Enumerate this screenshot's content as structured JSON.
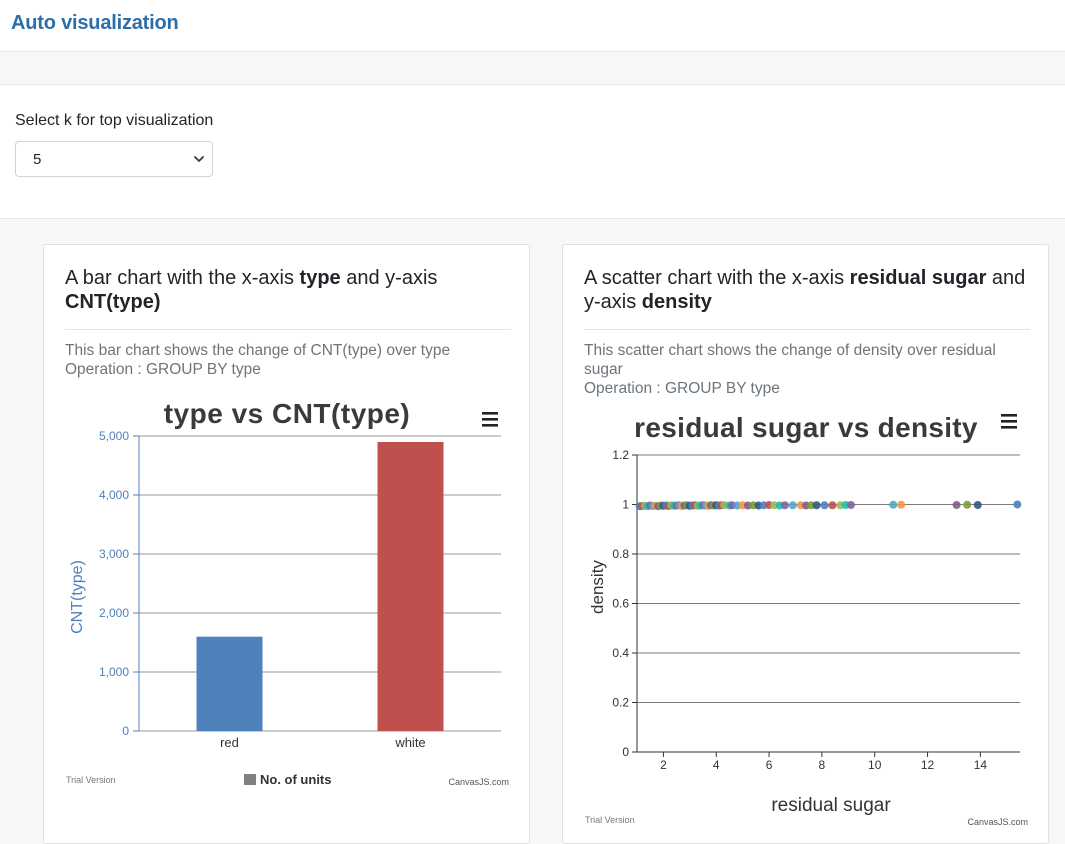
{
  "app": {
    "title": "Auto visualization"
  },
  "controls": {
    "k_label": "Select k for top visualization",
    "k_value": "5"
  },
  "cards": [
    {
      "title_parts": [
        "A bar chart with the x-axis ",
        "type",
        " and y-axis ",
        "CNT(type)"
      ],
      "description": "This bar chart shows the change of CNT(type) over type",
      "operation": "Operation : GROUP BY type",
      "footer_left": "Trial Version",
      "footer_right": "CanvasJS.com",
      "legend": "No. of units",
      "chart_data": {
        "type": "bar",
        "title": "type vs CNT(type)",
        "xlabel": "",
        "ylabel": "CNT(type)",
        "categories": [
          "red",
          "white"
        ],
        "values": [
          1599,
          4898
        ],
        "colors": [
          "#4f81bc",
          "#c0504e"
        ],
        "ylim": [
          0,
          5000
        ],
        "yticks": [
          "0",
          "1,000",
          "2,000",
          "3,000",
          "4,000",
          "5,000"
        ],
        "grid": true,
        "legend_position": "bottom"
      }
    },
    {
      "title_parts": [
        "A scatter chart with the x-axis ",
        "residual sugar",
        " and y-axis ",
        "density"
      ],
      "description": "This scatter chart shows the change of density over residual sugar",
      "operation": "Operation : GROUP BY type",
      "footer_left": "Trial Version",
      "footer_right": "CanvasJS.com",
      "chart_data": {
        "type": "scatter",
        "title": "residual sugar vs density",
        "xlabel": "residual sugar",
        "ylabel": "density",
        "xlim": [
          1,
          15.5
        ],
        "ylim": [
          0,
          1.2
        ],
        "xticks": [
          2,
          4,
          6,
          8,
          10,
          12,
          14
        ],
        "yticks": [
          "0",
          "0.2",
          "0.4",
          "0.6",
          "0.8",
          "1",
          "1.2"
        ],
        "grid": true,
        "point_colors": [
          "#4f81bc",
          "#c0504e",
          "#9bbb58",
          "#23bfaa",
          "#8064a1",
          "#4aacc5",
          "#f79647",
          "#7f6084",
          "#77a033",
          "#33558b"
        ],
        "points": [
          {
            "x": 1.1,
            "y": 0.993
          },
          {
            "x": 1.2,
            "y": 0.994
          },
          {
            "x": 1.3,
            "y": 0.995
          },
          {
            "x": 1.4,
            "y": 0.993
          },
          {
            "x": 1.5,
            "y": 0.996
          },
          {
            "x": 1.6,
            "y": 0.994
          },
          {
            "x": 1.7,
            "y": 0.995
          },
          {
            "x": 1.8,
            "y": 0.993
          },
          {
            "x": 1.9,
            "y": 0.996
          },
          {
            "x": 2.0,
            "y": 0.995
          },
          {
            "x": 2.1,
            "y": 0.996
          },
          {
            "x": 2.2,
            "y": 0.994
          },
          {
            "x": 2.3,
            "y": 0.997
          },
          {
            "x": 2.4,
            "y": 0.995
          },
          {
            "x": 2.5,
            "y": 0.996
          },
          {
            "x": 2.6,
            "y": 0.997
          },
          {
            "x": 2.7,
            "y": 0.994
          },
          {
            "x": 2.8,
            "y": 0.996
          },
          {
            "x": 2.9,
            "y": 0.997
          },
          {
            "x": 3.0,
            "y": 0.995
          },
          {
            "x": 3.1,
            "y": 0.996
          },
          {
            "x": 3.2,
            "y": 0.997
          },
          {
            "x": 3.3,
            "y": 0.995
          },
          {
            "x": 3.4,
            "y": 0.996
          },
          {
            "x": 3.5,
            "y": 0.997
          },
          {
            "x": 3.6,
            "y": 0.996
          },
          {
            "x": 3.7,
            "y": 0.995
          },
          {
            "x": 3.8,
            "y": 0.997
          },
          {
            "x": 3.9,
            "y": 0.996
          },
          {
            "x": 4.0,
            "y": 0.997
          },
          {
            "x": 4.1,
            "y": 0.996
          },
          {
            "x": 4.2,
            "y": 0.997
          },
          {
            "x": 4.3,
            "y": 0.998
          },
          {
            "x": 4.5,
            "y": 0.996
          },
          {
            "x": 4.6,
            "y": 0.997
          },
          {
            "x": 4.8,
            "y": 0.996
          },
          {
            "x": 5.0,
            "y": 0.997
          },
          {
            "x": 5.2,
            "y": 0.996
          },
          {
            "x": 5.4,
            "y": 0.997
          },
          {
            "x": 5.6,
            "y": 0.996
          },
          {
            "x": 5.8,
            "y": 0.997
          },
          {
            "x": 6.0,
            "y": 0.998
          },
          {
            "x": 6.2,
            "y": 0.997
          },
          {
            "x": 6.4,
            "y": 0.996
          },
          {
            "x": 6.6,
            "y": 0.997
          },
          {
            "x": 6.9,
            "y": 0.997
          },
          {
            "x": 7.2,
            "y": 0.997
          },
          {
            "x": 7.4,
            "y": 0.996
          },
          {
            "x": 7.6,
            "y": 0.997
          },
          {
            "x": 7.8,
            "y": 0.997
          },
          {
            "x": 8.1,
            "y": 0.997
          },
          {
            "x": 8.4,
            "y": 0.997
          },
          {
            "x": 8.7,
            "y": 0.997
          },
          {
            "x": 8.9,
            "y": 0.998
          },
          {
            "x": 9.1,
            "y": 0.998
          },
          {
            "x": 10.7,
            "y": 0.999
          },
          {
            "x": 11.0,
            "y": 0.999
          },
          {
            "x": 13.1,
            "y": 0.998
          },
          {
            "x": 13.5,
            "y": 0.999
          },
          {
            "x": 13.9,
            "y": 0.998
          },
          {
            "x": 15.4,
            "y": 1.0
          }
        ]
      }
    }
  ]
}
